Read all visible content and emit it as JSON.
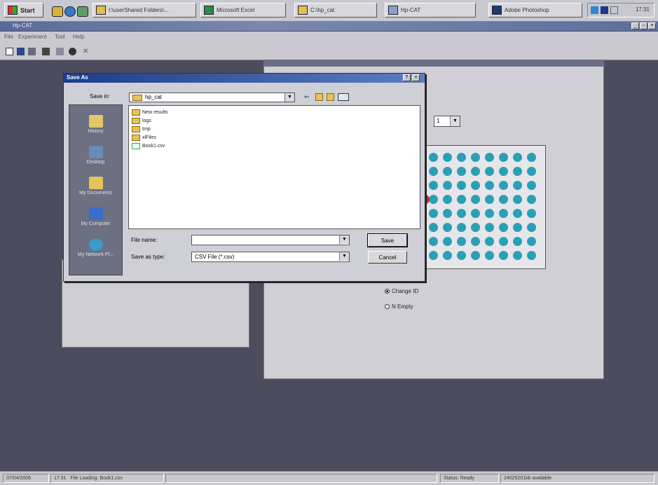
{
  "taskbar": {
    "start_label": "Start",
    "buttons": [
      {
        "label": "I:\\userShared Folders\\..."
      },
      {
        "label": "Microsoft Excel"
      },
      {
        "label": "C:\\hp_cat"
      },
      {
        "label": "Hp-CAT"
      },
      {
        "label": "Adobe Photoshop"
      }
    ],
    "clock": "17:31"
  },
  "app": {
    "title": "Hp-CAT",
    "menu": [
      "File",
      "Experiment",
      "Tool",
      "Help"
    ]
  },
  "workspace": {
    "plate_select_value": "1",
    "radio_options": [
      {
        "label": "Change ID",
        "selected": true
      },
      {
        "label": "N Empty",
        "selected": false
      }
    ],
    "plate": {
      "rows": 8,
      "cols": 8,
      "well_color": "#2aa0b4",
      "highlight_color": "#d02020"
    }
  },
  "dialog": {
    "title": "Save As",
    "save_in_label": "Save in:",
    "save_in_value": "hp_cat",
    "places": [
      {
        "label": "History",
        "icon": "history-icon"
      },
      {
        "label": "Desktop",
        "icon": "desktop-icon"
      },
      {
        "label": "My Documents",
        "icon": "my-documents-icon"
      },
      {
        "label": "My Computer",
        "icon": "my-computer-icon"
      },
      {
        "label": "My Network Pl...",
        "icon": "my-network-places-icon"
      }
    ],
    "files": [
      {
        "name": "New results",
        "type": "folder"
      },
      {
        "name": "logs",
        "type": "folder"
      },
      {
        "name": "tmp",
        "type": "folder"
      },
      {
        "name": "xlFiles",
        "type": "folder"
      },
      {
        "name": "Book1.csv",
        "type": "csv"
      }
    ],
    "file_name_label": "File name:",
    "file_name_value": "",
    "save_as_type_label": "Save as type:",
    "save_as_type_value": "CSV File (*.csv)",
    "save_label": "Save",
    "cancel_label": "Cancel"
  },
  "statusbar": {
    "date": "07/04/2006",
    "time": "17:31",
    "message": "File Loading: Book1.csv",
    "status": "Status: Ready",
    "memory": "24025201kb available"
  }
}
